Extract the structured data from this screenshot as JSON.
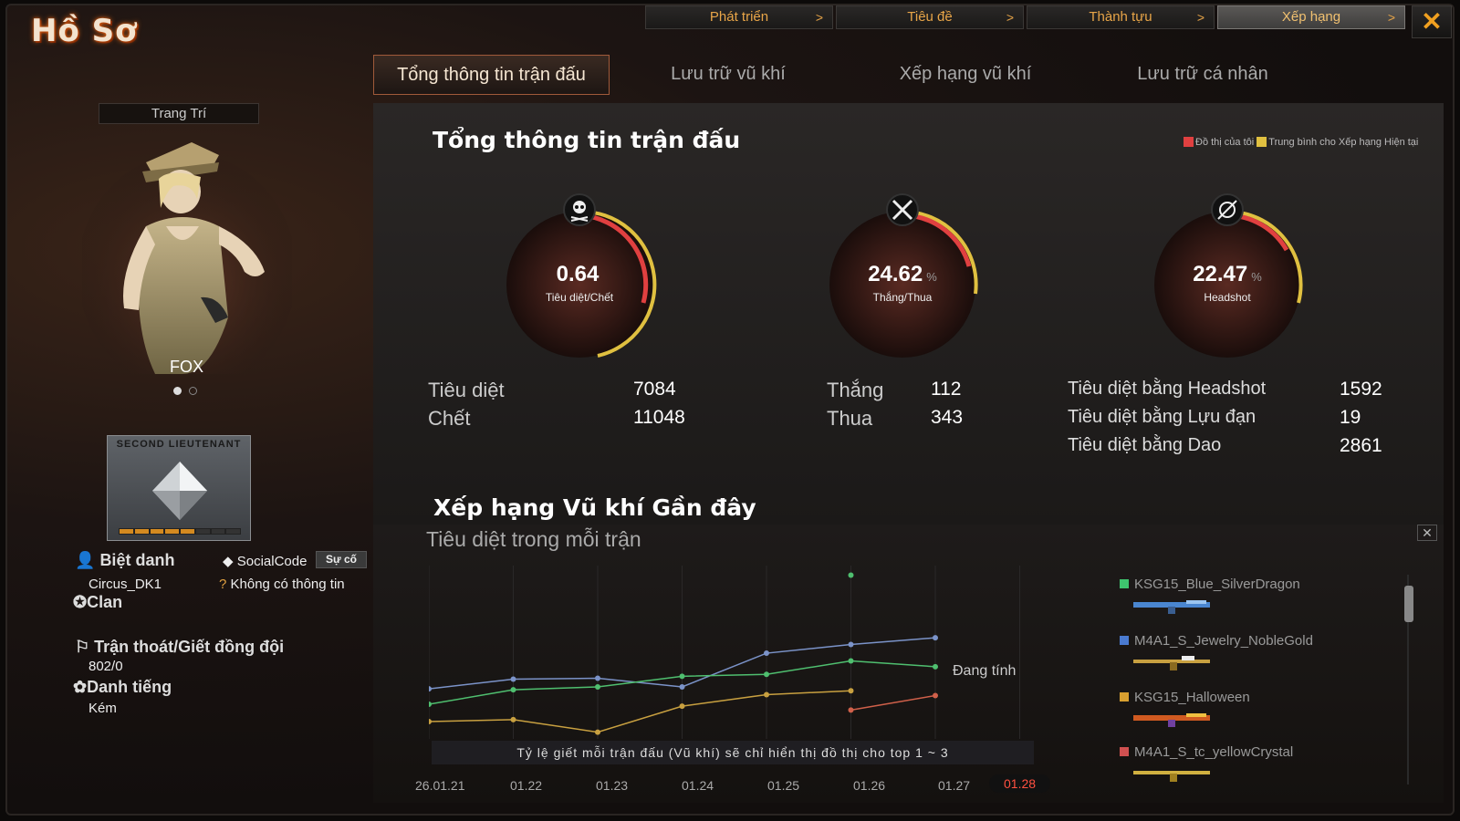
{
  "app": {
    "title": "Hồ Sơ"
  },
  "top_nav": [
    {
      "label": "Phát triển",
      "arrow": ">"
    },
    {
      "label": "Tiêu đề",
      "arrow": ">"
    },
    {
      "label": "Thành tựu",
      "arrow": ">"
    },
    {
      "label": "Xếp hạng",
      "arrow": ">"
    }
  ],
  "close_glyph": "✕",
  "tabs": [
    "Tổng thông tin trận đấu",
    "Lưu trữ vũ khí",
    "Xếp hạng vũ khí",
    "Lưu trữ cá nhân"
  ],
  "profile": {
    "deco_label": "Trang Trí",
    "character_name": "FOX",
    "rank_name": "SECOND LIEUTENANT",
    "rank_progress": "5 of 8",
    "nickname_label": "Biệt danh",
    "nickname": "Circus_DK1",
    "social_label": "SocialCode",
    "social_button": "Sự cố",
    "social_value": "Không có thông tin",
    "clan_label": "Clan",
    "desert_label": "Trận thoát/Giết đồng đội",
    "desert_value": "802/0",
    "reputation_label": "Danh tiếng",
    "reputation_value": "Kém"
  },
  "summary": {
    "title": "Tổng thông tin trận đấu",
    "legend_mine": "Đồ thị của tôi",
    "legend_avg": "Trung bình cho Xếp hạng Hiện tại",
    "colors": {
      "mine": "#e04040",
      "avg": "#e0c040"
    },
    "gauges": [
      {
        "value": "0.64",
        "suffix": "",
        "label": "Tiêu diệt/Chết",
        "icon": "skull-icon"
      },
      {
        "value": "24.62",
        "suffix": "%",
        "label": "Thắng/Thua",
        "icon": "crossed-swords-icon"
      },
      {
        "value": "22.47",
        "suffix": "%",
        "label": "Headshot",
        "icon": "target-icon"
      }
    ],
    "kd": [
      {
        "label": "Tiêu diệt",
        "value": "7084"
      },
      {
        "label": "Chết",
        "value": "11048"
      }
    ],
    "wl": [
      {
        "label": "Thắng",
        "value": "112"
      },
      {
        "label": "Thua",
        "value": "343"
      }
    ],
    "special": [
      {
        "label": "Tiêu diệt bằng Headshot",
        "value": "1592"
      },
      {
        "label": "Tiêu diệt bằng Lựu đạn",
        "value": "19"
      },
      {
        "label": "Tiêu diệt bằng Dao",
        "value": "2861"
      }
    ]
  },
  "weapon_rank": {
    "title": "Xếp hạng Vũ khí Gần đây",
    "subtitle": "Tiêu diệt trong mỗi trận",
    "note": "Tỷ lệ giết mỗi trận đấu (Vũ khí) sẽ chỉ hiển thị đồ thị cho top 1 ~ 3",
    "calculating": "Đang tính",
    "close_glyph": "✕",
    "weapons": [
      {
        "name": "KSG15_Blue_SilverDragon",
        "color": "#3ec46e"
      },
      {
        "name": "M4A1_S_Jewelry_NobleGold",
        "color": "#4a7ad0"
      },
      {
        "name": "KSG15_Halloween",
        "color": "#d9a030"
      },
      {
        "name": "M4A1_S_tc_yellowCrystal",
        "color": "#d05050"
      }
    ]
  },
  "chart_data": {
    "type": "line",
    "x": [
      "26.01.21",
      "01.22",
      "01.23",
      "01.24",
      "01.25",
      "01.26",
      "01.27",
      "01.28"
    ],
    "active_x": "01.28",
    "series": [
      {
        "color": "#7b93c9",
        "values": [
          0.42,
          0.52,
          0.53,
          0.44,
          0.79,
          0.88,
          0.95,
          null
        ]
      },
      {
        "color": "#4fbf6f",
        "values": [
          0.26,
          0.41,
          0.44,
          0.55,
          0.57,
          0.71,
          0.65,
          null
        ]
      },
      {
        "color": "#c8a040",
        "values": [
          0.08,
          0.1,
          -0.03,
          0.24,
          0.36,
          0.4,
          null,
          null
        ]
      },
      {
        "color": "#d0604a",
        "values": [
          null,
          null,
          null,
          null,
          null,
          0.2,
          0.35,
          null
        ]
      }
    ],
    "outlier": {
      "series": 1,
      "x": "01.26",
      "value": 1.6
    }
  }
}
